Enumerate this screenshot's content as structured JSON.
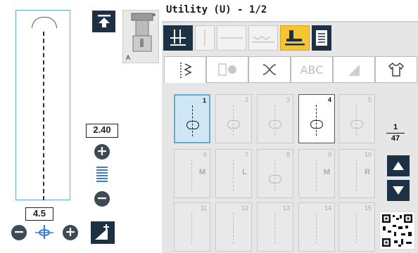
{
  "header": {
    "title": "Utility (U) - 1/2"
  },
  "left": {
    "width_value": "2.40",
    "position_value": "4.5",
    "foot_label": "A",
    "plus": "+",
    "minus": "−"
  },
  "tabs": [
    {
      "label": "",
      "icon": "utility-stitch-icon"
    },
    {
      "label": "",
      "icon": "buttonhole-icon"
    },
    {
      "label": "",
      "icon": "decorative-stitch-icon"
    },
    {
      "label": "ABC"
    },
    {
      "label": "",
      "icon": "quilting-icon"
    },
    {
      "label": "",
      "icon": "shirt-icon"
    }
  ],
  "stitches": [
    {
      "num": "1",
      "state": "selected"
    },
    {
      "num": "2"
    },
    {
      "num": "3"
    },
    {
      "num": "4",
      "state": "white"
    },
    {
      "num": "5"
    },
    {
      "num": "6",
      "letter": "M"
    },
    {
      "num": "7",
      "letter": "L"
    },
    {
      "num": "8"
    },
    {
      "num": "9",
      "letter": "M"
    },
    {
      "num": "10",
      "letter": "R"
    },
    {
      "num": "11"
    },
    {
      "num": "12"
    },
    {
      "num": "13"
    },
    {
      "num": "14"
    },
    {
      "num": "15"
    }
  ],
  "pagination": {
    "current": "1",
    "total": "47"
  },
  "colors": {
    "dark": "#1c3144",
    "accent_yellow": "#f6c531",
    "selection": "#cfe7f5"
  }
}
